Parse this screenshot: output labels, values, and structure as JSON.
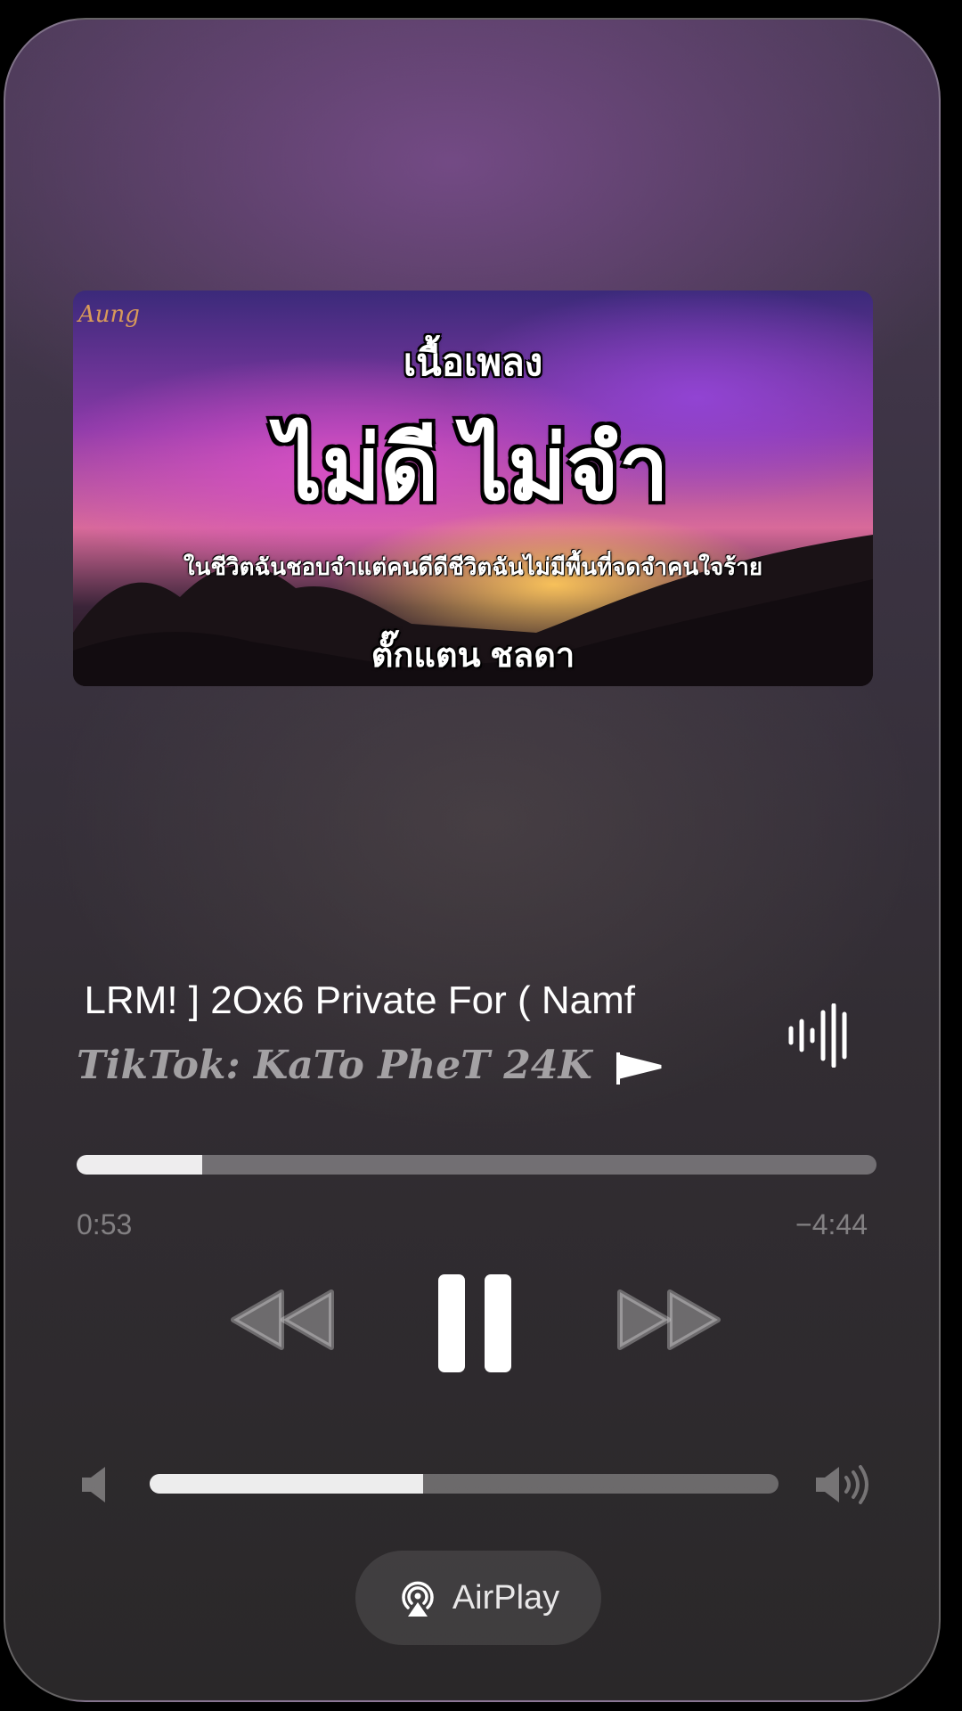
{
  "artwork": {
    "signature": "Aung",
    "subtitle": "เนื้อเพลง",
    "title": "ไม่ดี ไม่จำ",
    "lyric_line": "ในชีวิตฉันชอบจำแต่คนดีดีชีวิตฉันไม่มีพื้นที่จดจำคนใจร้าย",
    "artist": "ตั๊กแตน ชลดา"
  },
  "now_playing": {
    "title": "[ LRM! ] 2Ox6 Private For ( Namf",
    "artist": "TikTok: KaTo PheT 24K"
  },
  "playback": {
    "elapsed": "0:53",
    "remaining": "−4:44",
    "progress": 0.157
  },
  "volume": {
    "level": 0.435
  },
  "airplay": {
    "label": "AirPlay"
  }
}
